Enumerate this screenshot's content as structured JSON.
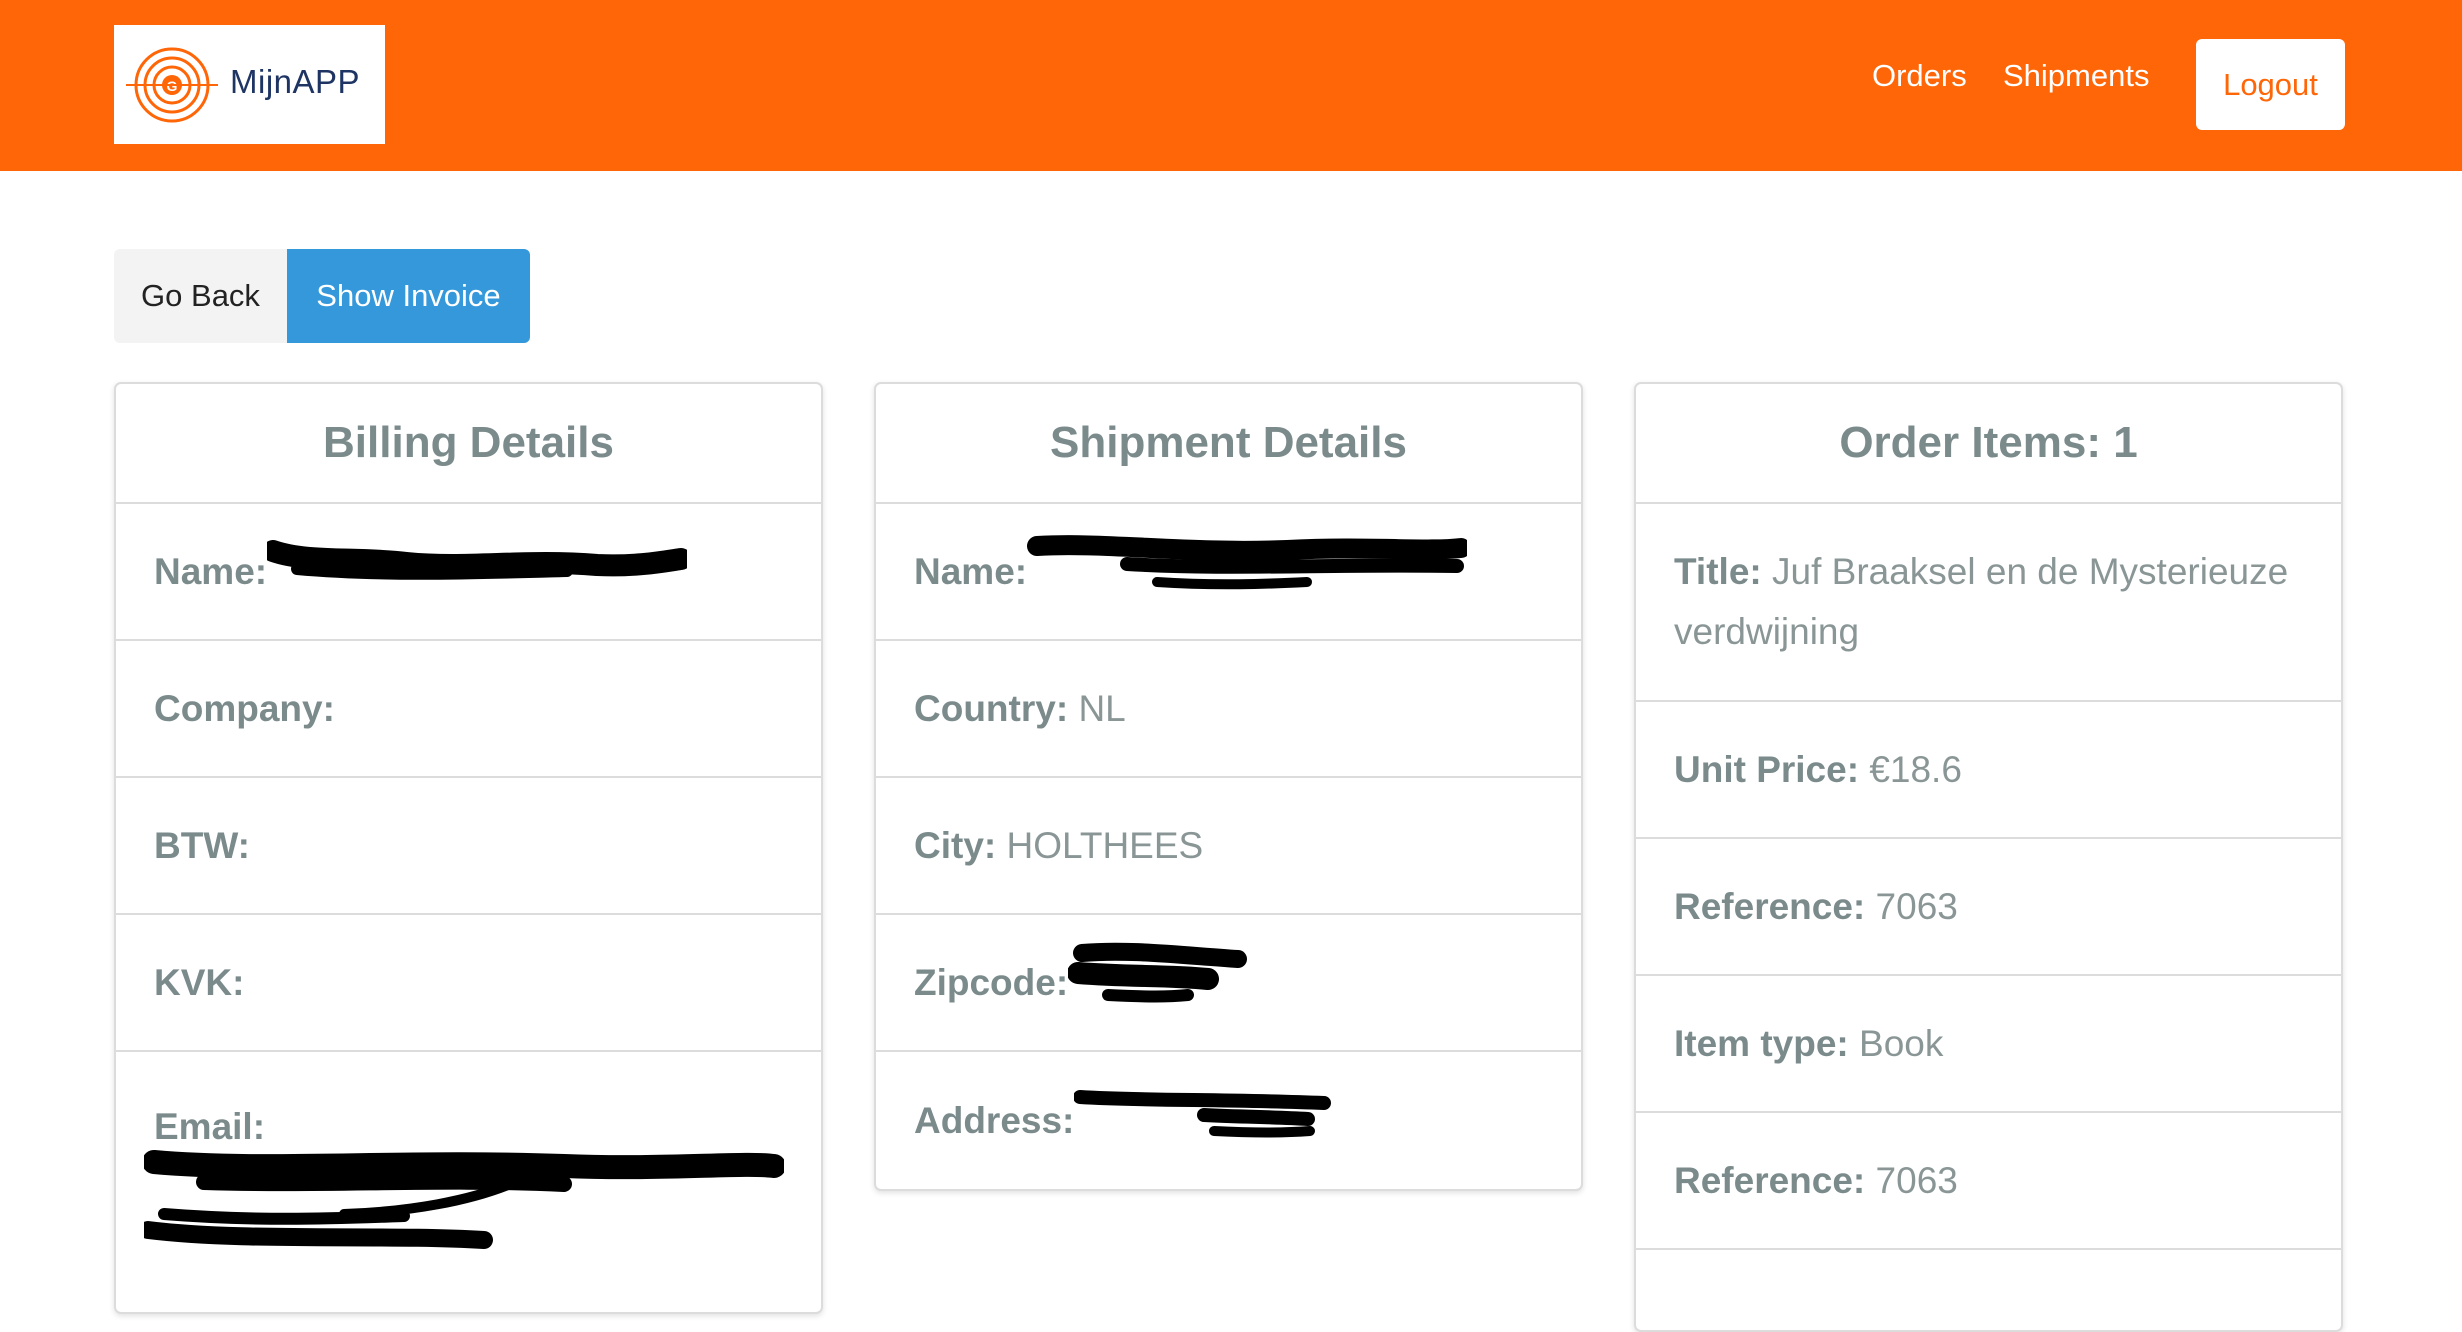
{
  "header": {
    "logo_text": "MijnAPP",
    "logo_icon": "target-g-logo-icon",
    "nav": [
      "Orders",
      "Shipments"
    ],
    "logout_label": "Logout"
  },
  "actions": {
    "back_label": "Go Back",
    "invoice_label": "Show Invoice"
  },
  "billing": {
    "title": "Billing Details",
    "name_label": "Name:",
    "company_label": "Company:",
    "btw_label": "BTW:",
    "kvk_label": "KVK:",
    "email_label": "Email:"
  },
  "shipment": {
    "title": "Shipment Details",
    "name_label": "Name:",
    "country_label": "Country:",
    "country_value": "NL",
    "city_label": "City:",
    "city_value": "HOLTHEES",
    "zipcode_label": "Zipcode:",
    "address_label": "Address:"
  },
  "order_items": {
    "title": "Order Items: 1",
    "title_label": "Title:",
    "title_value": "Juf Braaksel en de Mysterieuze verdwijning",
    "unit_price_label": "Unit Price:",
    "unit_price_value": "€18.6",
    "reference_label": "Reference:",
    "reference_value": "7063",
    "item_type_label": "Item type:",
    "item_type_value": "Book",
    "reference2_label": "Reference:",
    "reference2_value": "7063"
  },
  "colors": {
    "brand": "#ff6608",
    "primary_button": "#3498db",
    "text_muted": "#7b8a8b"
  }
}
